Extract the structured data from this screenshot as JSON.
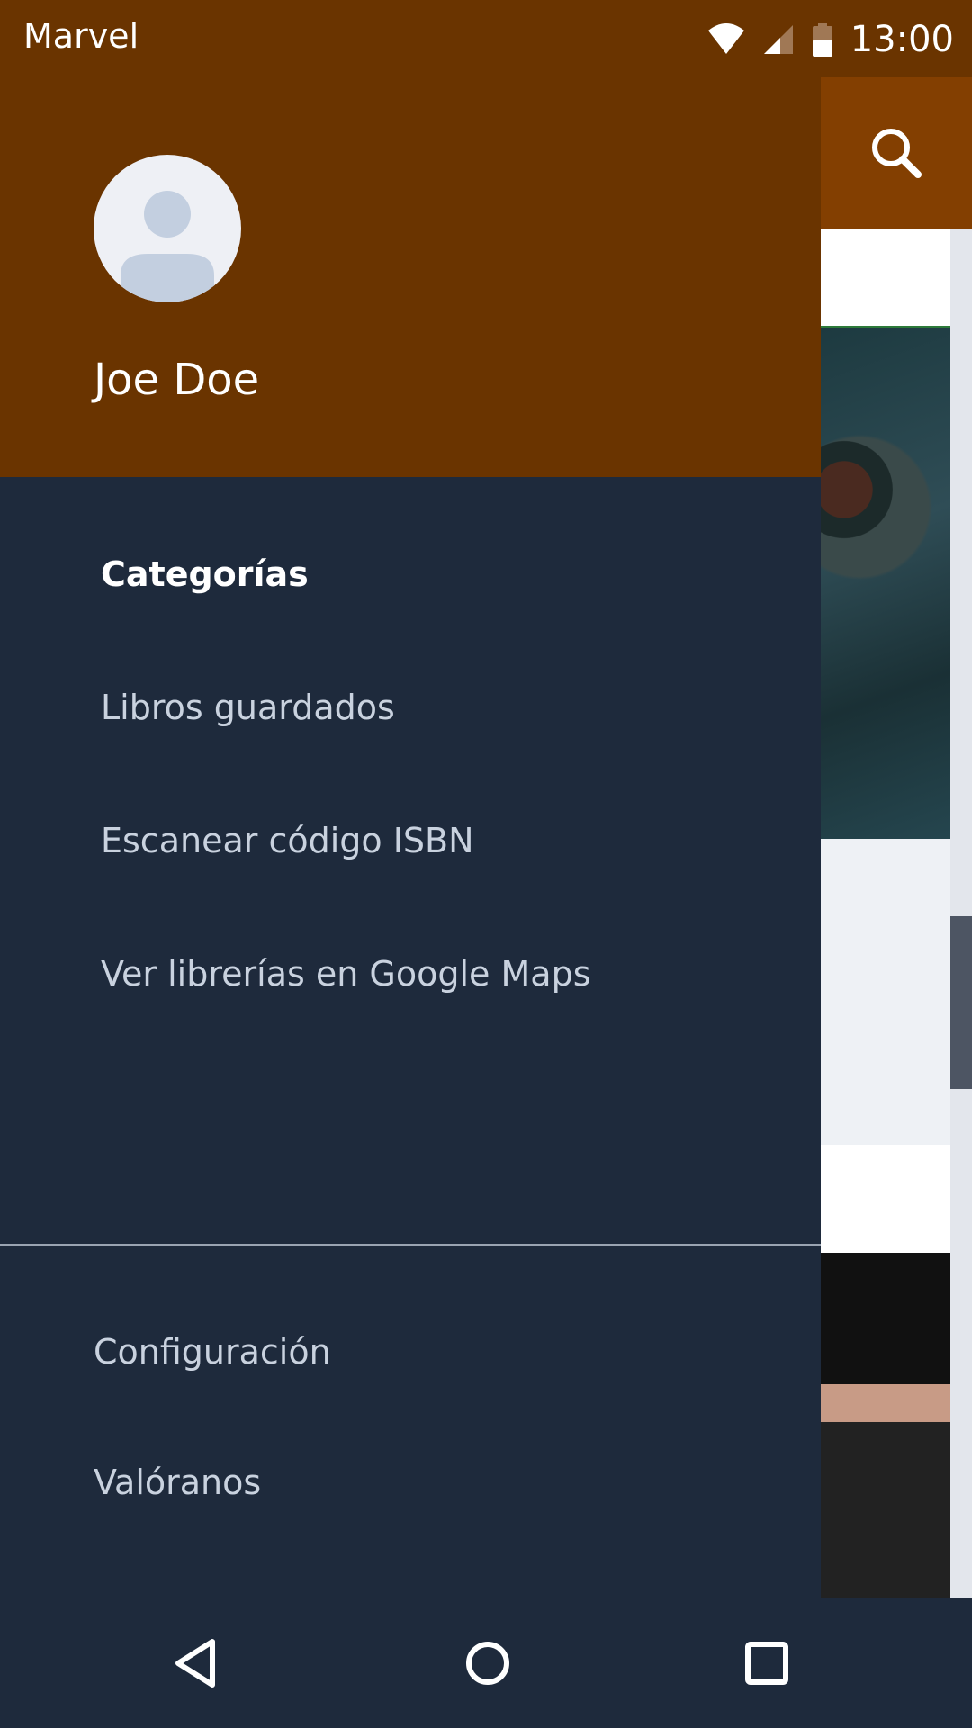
{
  "status_bar": {
    "app_label": "Marvel",
    "time": "13:00",
    "icons": [
      "wifi-icon",
      "cell-signal-icon",
      "battery-icon"
    ]
  },
  "app": {
    "toolbar_icon": "search-icon",
    "colors": {
      "toolbar": "#833f01",
      "status": "#6a3400"
    }
  },
  "drawer": {
    "header": {
      "user_name": "Joe Doe",
      "avatar_icon": "account-placeholder-icon"
    },
    "items": [
      {
        "label": "Categorías",
        "active": true
      },
      {
        "label": "Libros guardados",
        "active": false
      },
      {
        "label": "Escanear código ISBN",
        "active": false
      },
      {
        "label": "Ver librerías en Google Maps",
        "active": false
      }
    ],
    "bottom_items": [
      {
        "label": "Configuración"
      },
      {
        "label": "Valóranos"
      }
    ],
    "colors": {
      "background": "#1e2a3c",
      "header": "#6a3400"
    }
  },
  "nav_bar": {
    "buttons": [
      "back-icon",
      "home-icon",
      "recents-icon"
    ]
  }
}
